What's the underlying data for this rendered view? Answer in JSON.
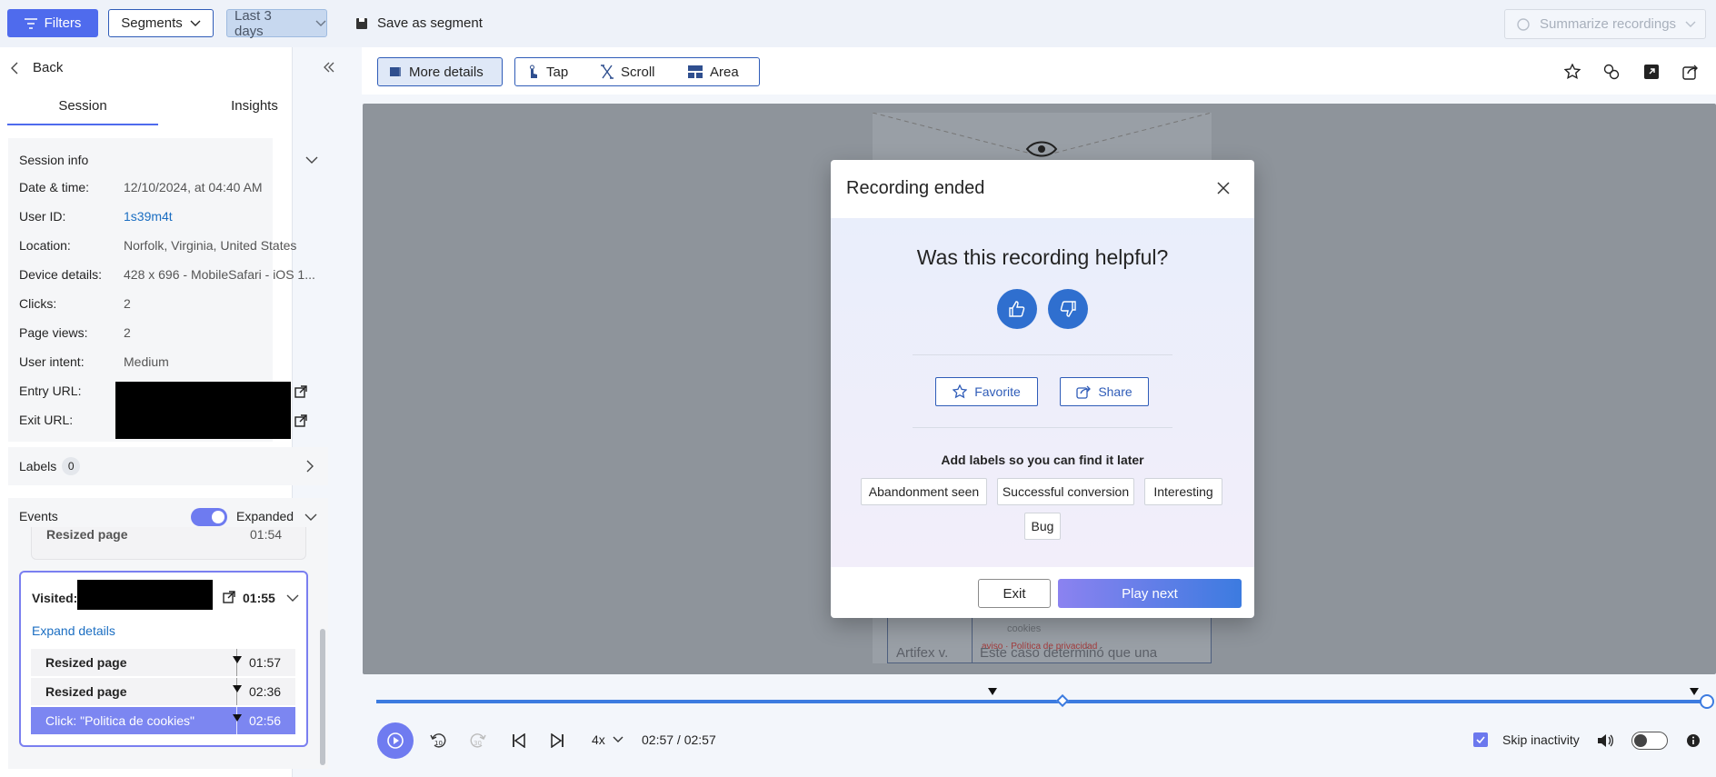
{
  "topbar": {
    "filters": "Filters",
    "segments": "Segments",
    "date_range": "Last 3 days",
    "save_segment": "Save as segment",
    "summarize": "Summarize recordings"
  },
  "left": {
    "back": "Back",
    "tabs": [
      "Session",
      "Insights"
    ],
    "session_info": {
      "title": "Session info",
      "rows": [
        {
          "label": "Date & time:",
          "value": "12/10/2024, at 04:40 AM"
        },
        {
          "label": "User ID:",
          "value": "1s39m4t"
        },
        {
          "label": "Location:",
          "value": "Norfolk, Virginia, United States"
        },
        {
          "label": "Device details:",
          "value": "428 x 696 - MobileSafari - iOS 1..."
        },
        {
          "label": "Clicks:",
          "value": "2"
        },
        {
          "label": "Page views:",
          "value": "2"
        },
        {
          "label": "User intent:",
          "value": "Medium"
        },
        {
          "label": "Entry URL:",
          "value": ""
        },
        {
          "label": "Exit URL:",
          "value": ""
        }
      ]
    },
    "labels": {
      "title": "Labels",
      "count": "0"
    },
    "events": {
      "title": "Events",
      "toggle_label": "Expanded",
      "prev_event": "Resized page",
      "prev_time": "01:54",
      "visited_label": "Visited:",
      "visited_time": "01:55",
      "expand": "Expand details",
      "items": [
        {
          "label": "Resized page",
          "time": "01:57"
        },
        {
          "label": "Resized page",
          "time": "02:36"
        },
        {
          "label": "Click: \"Politica de cookies\"",
          "time": "02:56"
        }
      ]
    }
  },
  "toolbar": {
    "more_details": "More details",
    "tap": "Tap",
    "scroll": "Scroll",
    "area": "Area"
  },
  "page_bg": {
    "cookies": "cookies",
    "row_left": "Artifex v.",
    "row_right": "Este caso determinó que una",
    "red_text": "aviso · Política de privacidad"
  },
  "dialog": {
    "title": "Recording ended",
    "question": "Was this recording helpful?",
    "favorite": "Favorite",
    "share": "Share",
    "labels_title": "Add labels so you can find it later",
    "labels": [
      "Abandonment seen",
      "Successful conversion",
      "Interesting",
      "Bug"
    ],
    "exit": "Exit",
    "play_next": "Play next"
  },
  "controls": {
    "speed": "4x",
    "time": "02:57 / 02:57",
    "skip_inactivity": "Skip inactivity",
    "skip_checked": true,
    "progress": 1.0
  },
  "colors": {
    "accent": "#4f6bed",
    "link": "#1b6ec2",
    "timeline": "#3c7be0"
  }
}
